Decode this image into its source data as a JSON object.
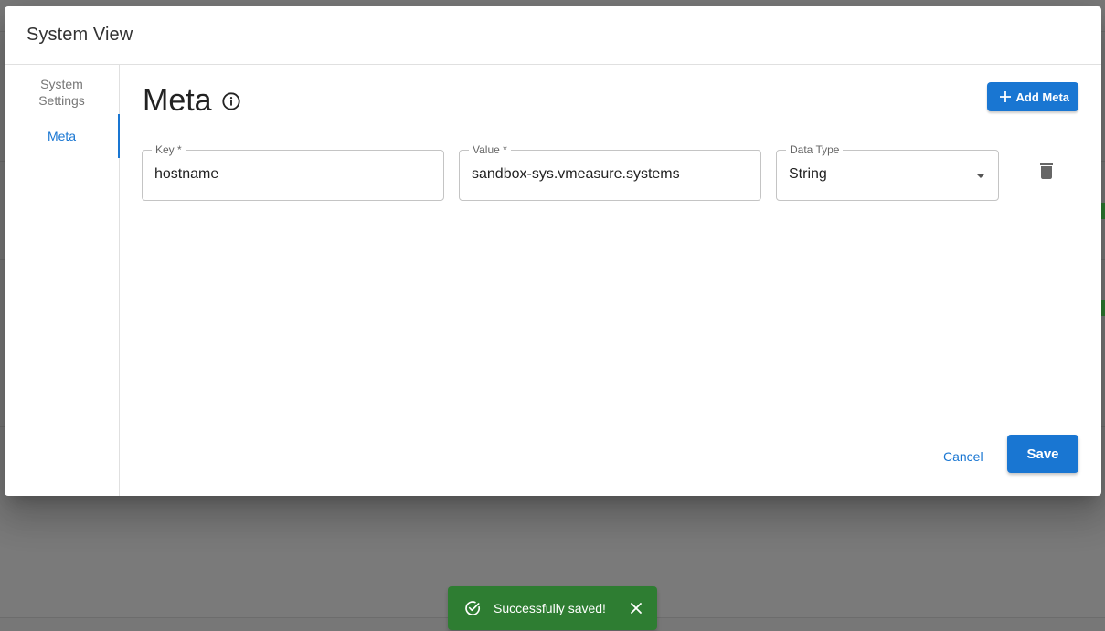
{
  "dialog": {
    "title": "System View"
  },
  "sidebar": {
    "items": [
      {
        "label": "System Settings",
        "active": false
      },
      {
        "label": "Meta",
        "active": true
      }
    ]
  },
  "meta": {
    "heading": "Meta",
    "add_button_label": "Add Meta",
    "fields": {
      "key": {
        "label": "Key *",
        "value": "hostname"
      },
      "value": {
        "label": "Value *",
        "value": "sandbox-sys.vmeasure.systems"
      },
      "data_type": {
        "label": "Data Type",
        "selected": "String"
      }
    }
  },
  "actions": {
    "cancel_label": "Cancel",
    "save_label": "Save"
  },
  "snackbar": {
    "message": "Successfully saved!"
  },
  "colors": {
    "primary": "#1976d2",
    "success": "#2e7d32"
  },
  "icons": [
    "info-icon",
    "plus-icon",
    "trash-icon",
    "dropdown-arrow-icon",
    "check-circle-icon",
    "close-icon"
  ]
}
